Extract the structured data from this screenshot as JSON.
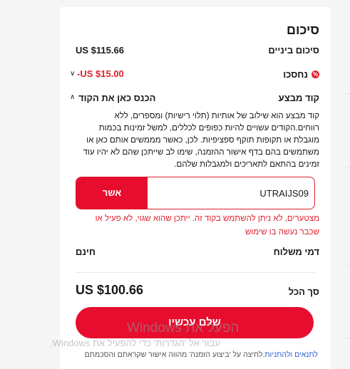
{
  "summary": {
    "title": "סיכום",
    "subtotal_label": "סיכום ביניים",
    "subtotal_value": "US $115.66",
    "saved_label": "נחסכו",
    "saved_value": "-US $15.00",
    "discount_icon": "%"
  },
  "promo": {
    "label": "קוד מבצע",
    "enter_link": "הכנס כאן את הקוד",
    "description": "קוד מבצע הוא שילוב של אותיות (תלוי רישיות) ומספרים, ללא רווחים.הקודים עשויים להיות כפופים לכללים, למשל זמינות בכמות מוגבלת או תקופות תוקף ספציפיות. לכן, כאשר מממשים אותם כאן או משתמשים בהם בדף אישור ההזמנה, שימו לב שייתכן שהם לא יהיו עוד זמינים בהתאם לתאריכים ולמגבלות שלהם.",
    "input_value": "UTRAIJS09",
    "apply_label": "אשר",
    "error": "מצטערים, לא ניתן להשתמש בקוד זה. ייתכן שהוא שגוי, לא פעיל או שכבר נעשה בו שימוש"
  },
  "shipping": {
    "label": "דמי משלוח",
    "value": "חינם"
  },
  "total": {
    "label": "סך הכל",
    "value": "US $100.66"
  },
  "pay_button": "שלם עכשיו",
  "terms": {
    "prefix": "לחיצה על 'ביצוע הזמנה' מהווה אישור שקראתם והסכמתם",
    "link": "לתנאים ולהתניות."
  },
  "watermark": {
    "line1": "הפעל את Windows",
    "line2": "עבור אל 'הגדרות' כדי להפעיל את Windows."
  },
  "colors": {
    "accent": "#e60d2e",
    "error": "#e0202e",
    "link": "#2a5ecf"
  }
}
